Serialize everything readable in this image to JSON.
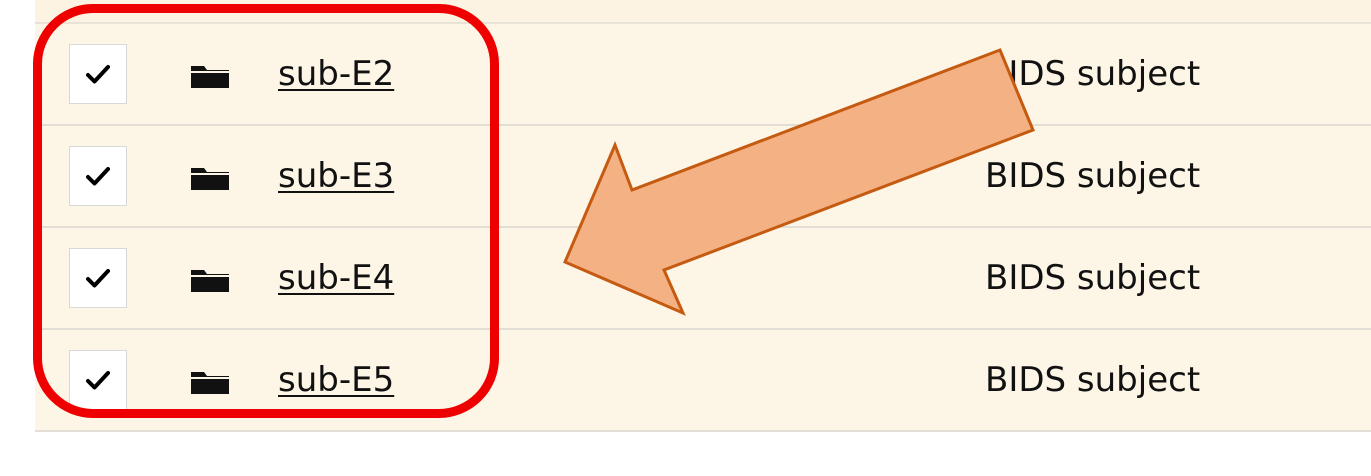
{
  "table": {
    "rows": [
      {
        "name": "sub-E2",
        "type": "BIDS subject",
        "checked": true
      },
      {
        "name": "sub-E3",
        "type": "BIDS subject",
        "checked": true
      },
      {
        "name": "sub-E4",
        "type": "BIDS subject",
        "checked": true
      },
      {
        "name": "sub-E5",
        "type": "BIDS subject",
        "checked": true
      }
    ]
  },
  "icons": {
    "row_checkbox": "checkmark-icon",
    "row_type": "folder-icon"
  },
  "annotations": {
    "highlight_color": "#ee0000",
    "arrow_fill": "#f4b183",
    "arrow_stroke": "#c55a11"
  },
  "colors": {
    "row_background": "#fdf5e6",
    "row_divider": "#e2ddd5"
  }
}
